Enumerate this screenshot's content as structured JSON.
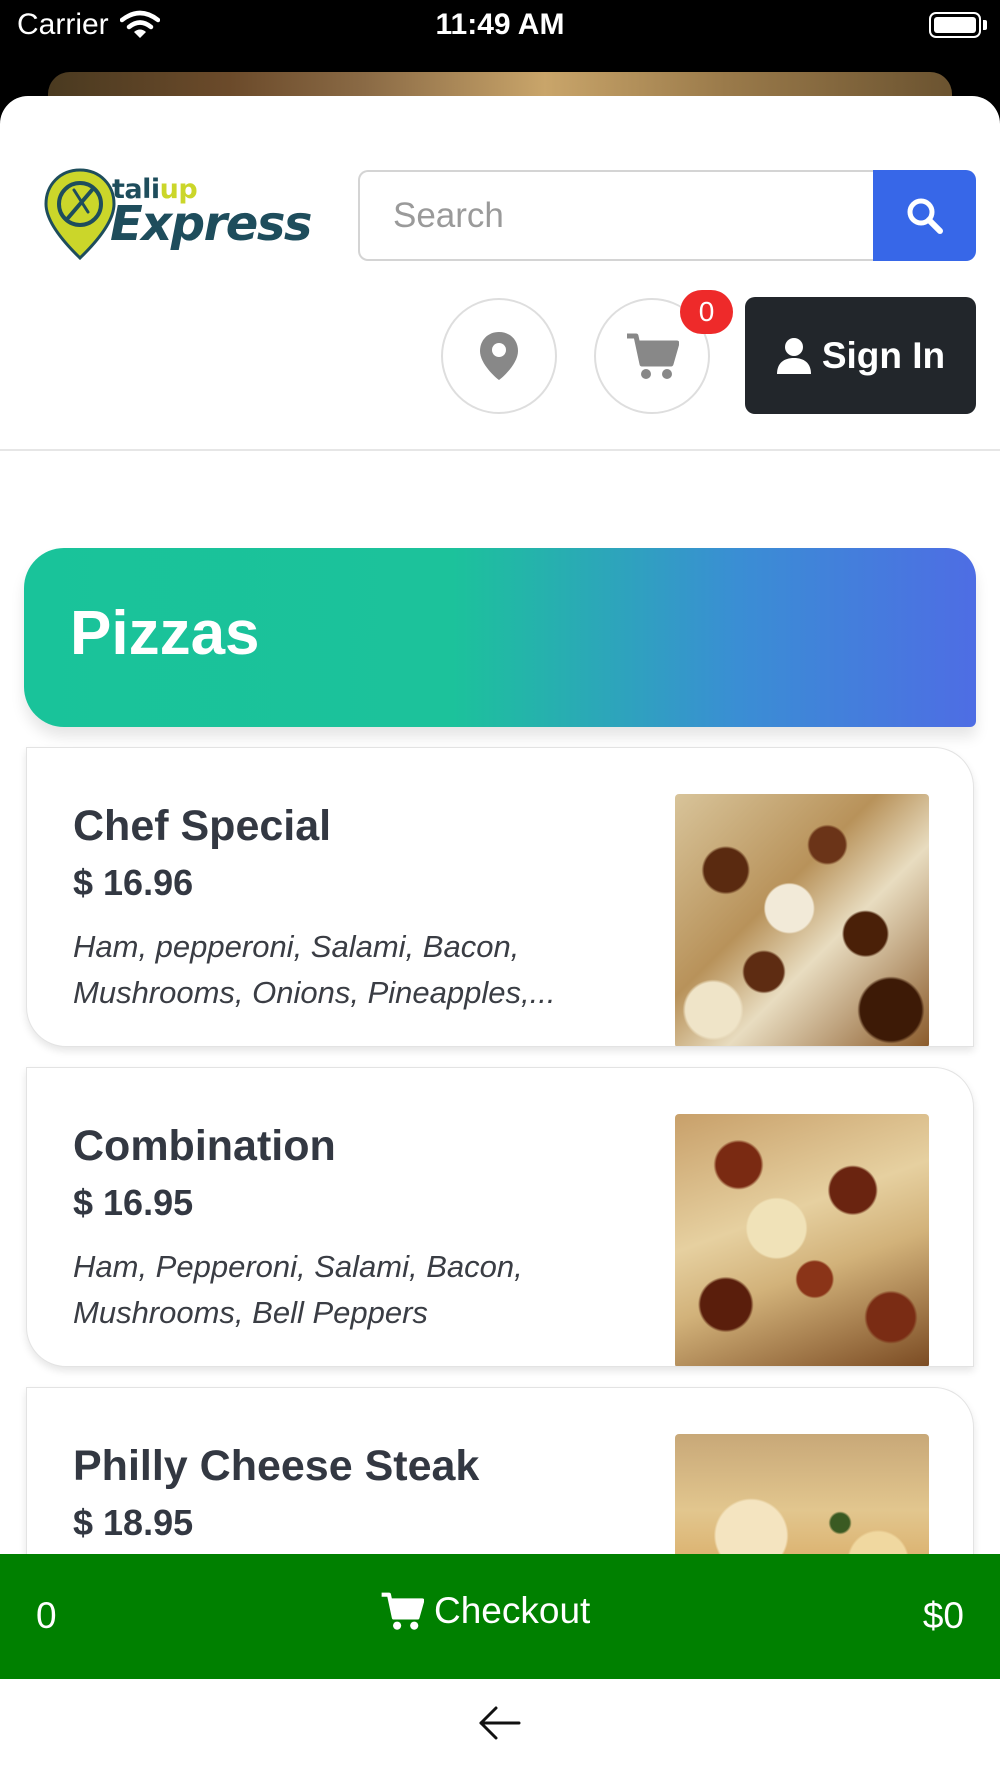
{
  "status_bar": {
    "carrier": "Carrier",
    "time": "11:49 AM"
  },
  "header": {
    "logo_small": "tali",
    "logo_small_accent": "up",
    "logo_big": "Express",
    "search": {
      "placeholder": "Search",
      "value": ""
    },
    "cart_badge": "0",
    "signin_label": "Sign In"
  },
  "category": {
    "title": "Pizzas"
  },
  "items": [
    {
      "name": "Chef Special",
      "price": "$ 16.96",
      "description": "Ham, pepperoni, Salami, Bacon, Mushrooms, Onions, Pineapples,..."
    },
    {
      "name": "Combination",
      "price": "$ 16.95",
      "description": "Ham, Pepperoni, Salami, Bacon, Mushrooms, Bell Peppers"
    },
    {
      "name": "Philly Cheese Steak",
      "price": "$ 18.95",
      "description": ""
    }
  ],
  "checkout": {
    "count": "0",
    "label": "Checkout",
    "total": "$0"
  },
  "colors": {
    "search_button": "#3767e8",
    "signin_button": "#22262b",
    "badge": "#ee2a2a",
    "checkout_bar": "#008000",
    "banner_start": "#19c39a",
    "banner_end": "#4e6de4"
  },
  "icons": [
    "wifi-icon",
    "battery-icon",
    "search-icon",
    "location-pin-icon",
    "cart-icon",
    "user-icon",
    "back-arrow-icon"
  ]
}
